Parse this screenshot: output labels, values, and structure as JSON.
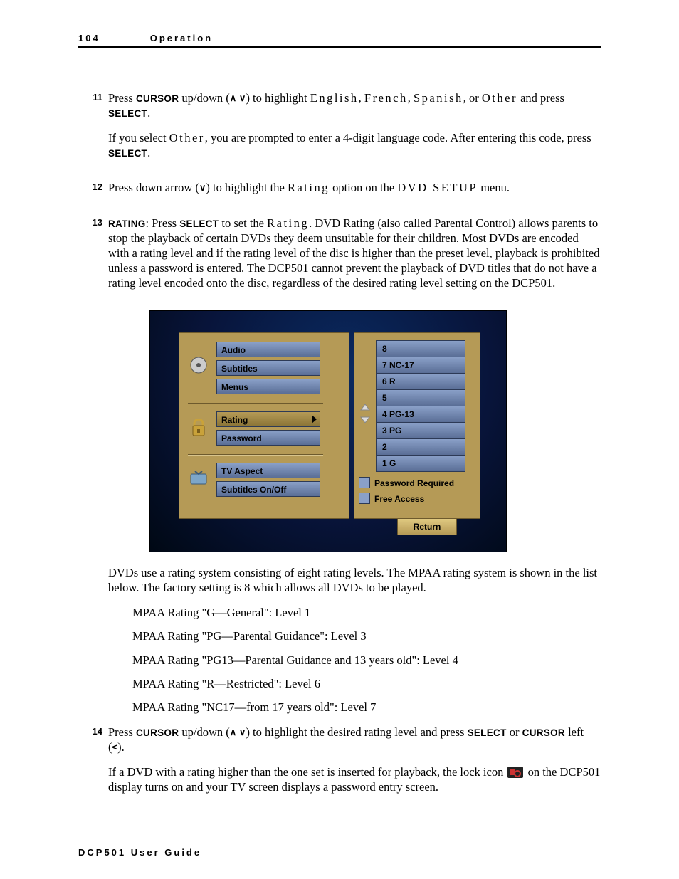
{
  "header": {
    "page_number": "104",
    "section": "Operation"
  },
  "footer": "DCP501 User Guide",
  "words": {
    "cursor": "CURSOR",
    "select": "SELECT",
    "rating_bold": "RATING"
  },
  "steps": {
    "s11": {
      "num": "11",
      "p1a": "Press ",
      "p1b": " up/down (",
      "arrows_ud": "∧ ∨",
      "p1c": ") to highlight ",
      "english": "English",
      "comma1": ", ",
      "french": "French",
      "comma2": ", ",
      "spanish": "Spanish",
      "or": ", or ",
      "other": "Other",
      "p1d": " and press ",
      "period": ".",
      "p2a": "If you select ",
      "p2b": ", you are prompted to enter a 4-digit language code. After entering this code, press ",
      "p2c": "."
    },
    "s12": {
      "num": "12",
      "p1a": "Press down arrow (",
      "arrow_d": "∨",
      "p1b": ") to highlight the ",
      "rating": "Rating",
      "p1c": " option on the ",
      "dvdsetup": "DVD SETUP",
      "p1d": " menu."
    },
    "s13": {
      "num": "13",
      "p1a": ": Press ",
      "p1b": " to set the ",
      "rating": "Rating",
      "p1c": ". DVD Rating (also called Parental Control) allows parents to stop the playback of certain DVDs they deem unsuitable for their children. Most DVDs are encoded with a rating level and if the rating level of the disc is higher than the preset level, playback is prohibited unless a password is entered. The DCP501 cannot prevent the playback of DVD titles that do not have a rating level encoded onto the disc, regardless of the desired rating level setting on the DCP501."
    },
    "after_fig": "DVDs use a rating system consisting of eight rating levels. The MPAA rating system is shown in the list below. The factory setting is 8 which allows all DVDs to be played.",
    "mpaa": [
      "MPAA Rating \"G—General\": Level 1",
      "MPAA Rating \"PG—Parental Guidance\": Level 3",
      "MPAA Rating \"PG13—Parental Guidance and 13 years old\": Level 4",
      "MPAA Rating \"R—Restricted\": Level 6",
      "MPAA Rating \"NC17—from 17 years old\": Level 7"
    ],
    "s14": {
      "num": "14",
      "p1a": "Press ",
      "p1b": " up/down (",
      "arrows_ud": "∧ ∨",
      "p1c": ") to highlight the desired rating level and press ",
      "p1d": " or ",
      "p1e": " left (",
      "arrow_l": "<",
      "p1f": ").",
      "p2a": "If a DVD with a rating higher than the one set is inserted for playback, the lock icon ",
      "p2b": " on the DCP501 display turns on and your TV screen displays a password entry screen."
    }
  },
  "figure": {
    "left": {
      "audio": "Audio",
      "subtitles": "Subtitles",
      "menus": "Menus",
      "rating": "Rating",
      "password": "Password",
      "tvaspect": "TV Aspect",
      "subonoff": "Subtitles On/Off"
    },
    "ratings": [
      "8",
      "7 NC-17",
      "6 R",
      "5",
      "4 PG-13",
      "3 PG",
      "2",
      "1 G"
    ],
    "legend1": "Password Required",
    "legend2": "Free Access",
    "return": "Return"
  }
}
